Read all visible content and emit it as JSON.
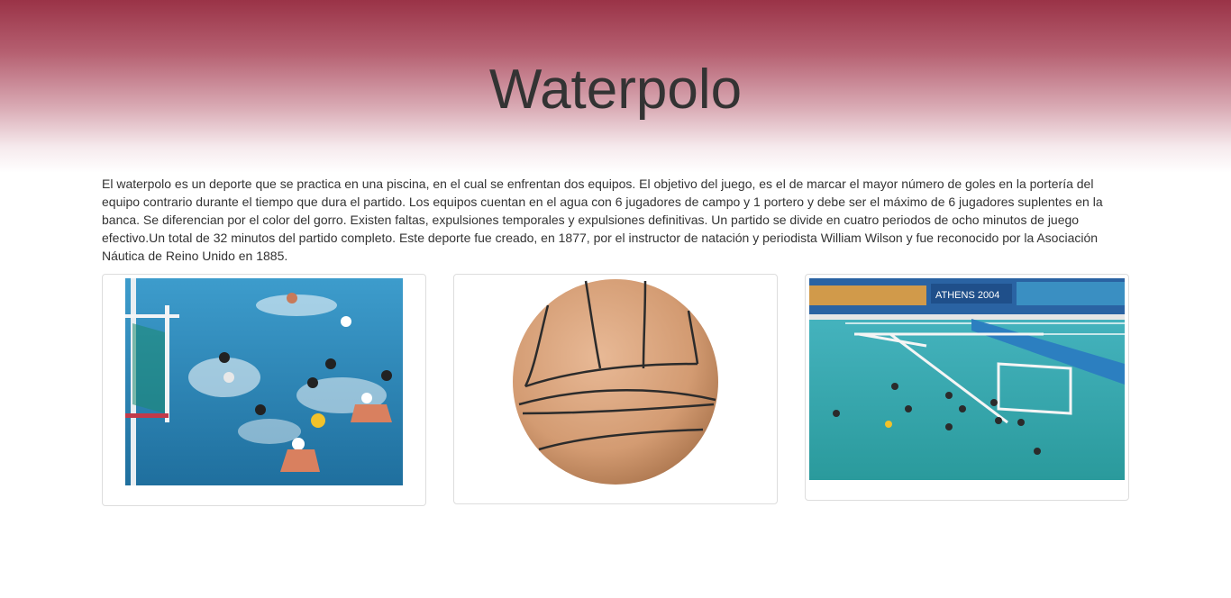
{
  "header": {
    "title": "Waterpolo"
  },
  "main": {
    "intro": "El waterpolo es un deporte que se practica en una piscina, en el cual se enfrentan dos equipos. El objetivo del juego, es el de marcar el mayor número de goles en la portería del equipo contrario durante el tiempo que dura el partido. Los equipos cuentan en el agua con 6 jugadores de campo y 1 portero y debe ser el máximo de 6 jugadores suplentes en la banca. Se diferencian por el color del gorro. Existen faltas, expulsiones temporales y expulsiones definitivas. Un partido se divide en cuatro periodos de ocho minutos de juego efectivo.Un total de 32 minutos del partido completo. Este deporte fue creado, en 1877, por el instructor de natación y periodista William Wilson y fue reconocido por la Asociación Náutica de Reino Unido en 1885."
  },
  "gallery": {
    "photo3_banner": "ATHENS 2004"
  },
  "colors": {
    "header_top": "#9a3347",
    "water": "#2f8fc0",
    "ball": "#d9a27a",
    "card_border": "#dddddd"
  }
}
